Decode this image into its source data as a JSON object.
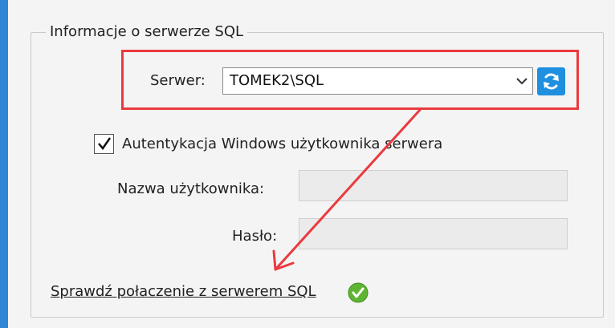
{
  "group": {
    "title": "Informacje o serwerze SQL"
  },
  "server": {
    "label": "Serwer:",
    "value": "TOMEK2\\SQL",
    "dropdown_icon": "chevron-down-icon",
    "refresh_icon": "refresh-icon"
  },
  "auth": {
    "checkbox_label": "Autentykacja Windows użytkownika serwera",
    "checked": true
  },
  "username": {
    "label": "Nazwa użytkownika:",
    "value": ""
  },
  "password": {
    "label": "Hasło:",
    "value": ""
  },
  "test_connection": {
    "link_label": "Sprawdź połaczenie z serwerem SQL",
    "status_icon": "check-circle-icon"
  },
  "colors": {
    "accent": "#2f86d6",
    "refresh_button": "#1f8fe0",
    "highlight": "#ea3a3e",
    "success": "#5fb532"
  }
}
